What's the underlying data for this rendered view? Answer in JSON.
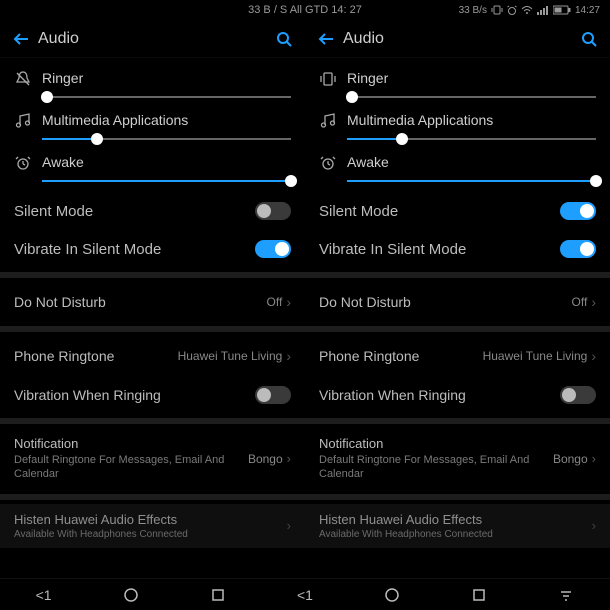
{
  "status": {
    "center": "33 B / S All GTD 14: 27",
    "right_speed": "33 B/s",
    "right_time": "14:27"
  },
  "header": {
    "title": "Audio"
  },
  "sliders": {
    "ringer": {
      "label": "Ringer",
      "value": 2
    },
    "multimedia": {
      "label": "Multimedia Applications",
      "value": 22
    },
    "awake": {
      "label": "Awake",
      "value": 100
    }
  },
  "toggles": {
    "silent_left": {
      "label": "Silent Mode",
      "on": false
    },
    "silent_right": {
      "label": "Silent Mode",
      "on": true
    },
    "vibrate_silent": {
      "label": "Vibrate In Silent Mode",
      "on": true
    },
    "vibrate_ringing": {
      "label": "Vibration When Ringing",
      "on": false
    }
  },
  "items": {
    "dnd": {
      "label": "Do Not Disturb",
      "value": "Off"
    },
    "ringtone": {
      "label": "Phone Ringtone",
      "value": "Huawei Tune Living"
    },
    "notification": {
      "label": "Notification",
      "sub": "Default Ringtone For Messages, Email And Calendar",
      "value": "Bongo"
    },
    "histen": {
      "label": "Histen Huawei Audio Effects",
      "sub": "Available With Headphones Connected"
    }
  },
  "navbar": {
    "left": "<1",
    "right": "<1"
  }
}
